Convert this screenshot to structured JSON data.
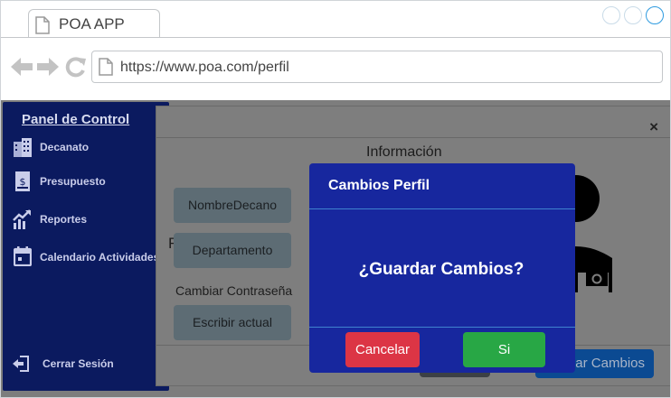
{
  "browser": {
    "tab_title": "POA APP",
    "url": "https://www.poa.com/perfil",
    "icons": [
      "document-icon",
      "back-arrow-icon",
      "forward-arrow-icon",
      "reload-icon"
    ]
  },
  "sidebar": {
    "title": "Panel de Control",
    "items": [
      {
        "label": "Decanato",
        "icon": "building-icon"
      },
      {
        "label": "Presupuesto",
        "icon": "budget-document-icon"
      },
      {
        "label": "Reportes",
        "icon": "chart-icon"
      },
      {
        "label": "Calendario Actividades",
        "icon": "calendar-icon"
      }
    ],
    "logout": {
      "label": "Cerrar Sesión",
      "icon": "logout-icon"
    }
  },
  "profile_modal": {
    "close": "×",
    "heading": "Información",
    "name_field": "NombreDecano",
    "r_label": "R",
    "department_field": "Departamento",
    "change_password_label": "Cambiar Contraseña",
    "password_field": "Escribir actual",
    "save_button": "Guardar Cambios"
  },
  "confirm_dialog": {
    "title": "Cambios Perfil",
    "question": "¿Guardar Cambios?",
    "cancel": "Cancelar",
    "confirm": "Si"
  },
  "colors": {
    "sidebar_bg": "#0b1a5f",
    "dialog_bg": "#17279e",
    "cancel": "#dc3545",
    "confirm": "#28a745",
    "overlay": "#7e7e7e"
  }
}
